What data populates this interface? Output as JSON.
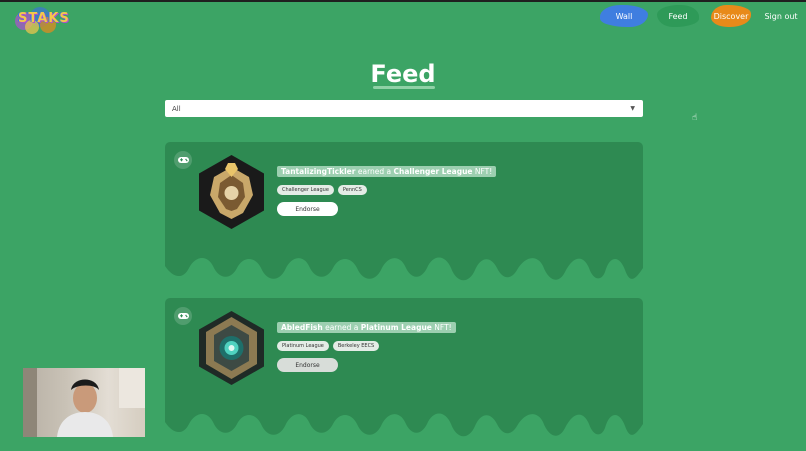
{
  "app": {
    "logo_text": "STAKS"
  },
  "nav": {
    "wall": "Wall",
    "feed": "Feed",
    "discover": "Discover",
    "sign_out": "Sign out"
  },
  "page": {
    "title": "Feed"
  },
  "filter": {
    "selected": "All"
  },
  "colors": {
    "background": "#3ca465",
    "card": "#2e8a52",
    "wall_blob": "#3f7ee0",
    "feed_blob": "#2e9a58",
    "discover_blob": "#e88a1a"
  },
  "feed": [
    {
      "user": "TantalizingTickler",
      "verb": "earned a",
      "achievement": "Challenger League",
      "suffix": "NFT!",
      "tags": [
        "Challenger League",
        "PennCS"
      ],
      "action": "Endorse",
      "icon": "gamepad-icon",
      "badge": "challenger-badge"
    },
    {
      "user": "AbledFish",
      "verb": "earned a",
      "achievement": "Platinum League",
      "suffix": "NFT!",
      "tags": [
        "Platinum League",
        "Berkeley EECS"
      ],
      "action": "Endorse",
      "icon": "gamepad-icon",
      "badge": "platinum-badge"
    }
  ]
}
